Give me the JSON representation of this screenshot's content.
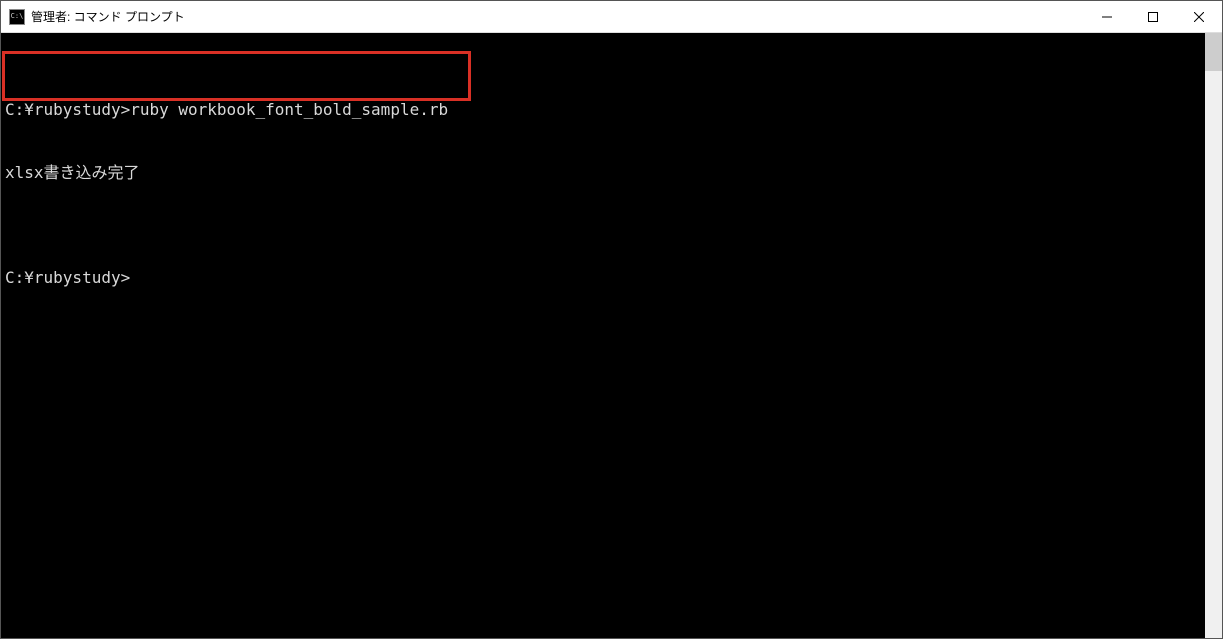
{
  "window": {
    "title": "管理者: コマンド プロンプト",
    "icon_label": "C:\\"
  },
  "terminal": {
    "lines": [
      "C:¥rubystudy>ruby workbook_font_bold_sample.rb",
      "xlsx書き込み完了",
      "",
      "C:¥rubystudy>"
    ]
  }
}
